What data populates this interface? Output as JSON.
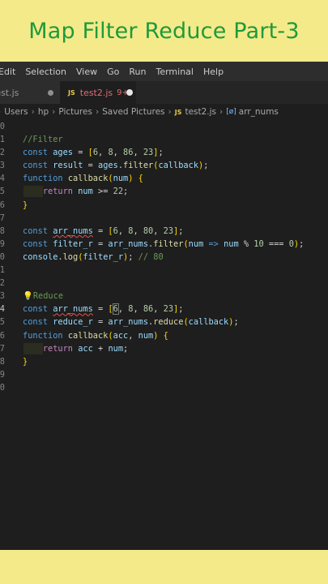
{
  "banner": {
    "title": "Map Filter Reduce Part-3"
  },
  "menubar": {
    "items": [
      "Edit",
      "Selection",
      "View",
      "Go",
      "Run",
      "Terminal",
      "Help"
    ]
  },
  "tabs": {
    "inactive": {
      "label": "test.js"
    },
    "active": {
      "icon": "JS",
      "label": "test2.js",
      "badge": "9+"
    }
  },
  "breadcrumb": {
    "segments": [
      "Users",
      "hp",
      "Pictures",
      "Saved Pictures"
    ],
    "file": "test2.js",
    "symbol": "arr_nums"
  },
  "code": {
    "line_numbers": [
      "0",
      "1",
      "2",
      "3",
      "4",
      "5",
      "6",
      "7",
      "8",
      "9",
      "0",
      "1",
      "2",
      "3",
      "4",
      "5",
      "6",
      "7",
      "8",
      "9",
      "0"
    ],
    "comment_filter": "//Filter",
    "comment_result": "// 80",
    "comment_reduce": "Reduce"
  },
  "colors": {
    "banner_bg": "#f4ea8a",
    "banner_text": "#1f9a3a",
    "editor_bg": "#1e1e1e"
  }
}
